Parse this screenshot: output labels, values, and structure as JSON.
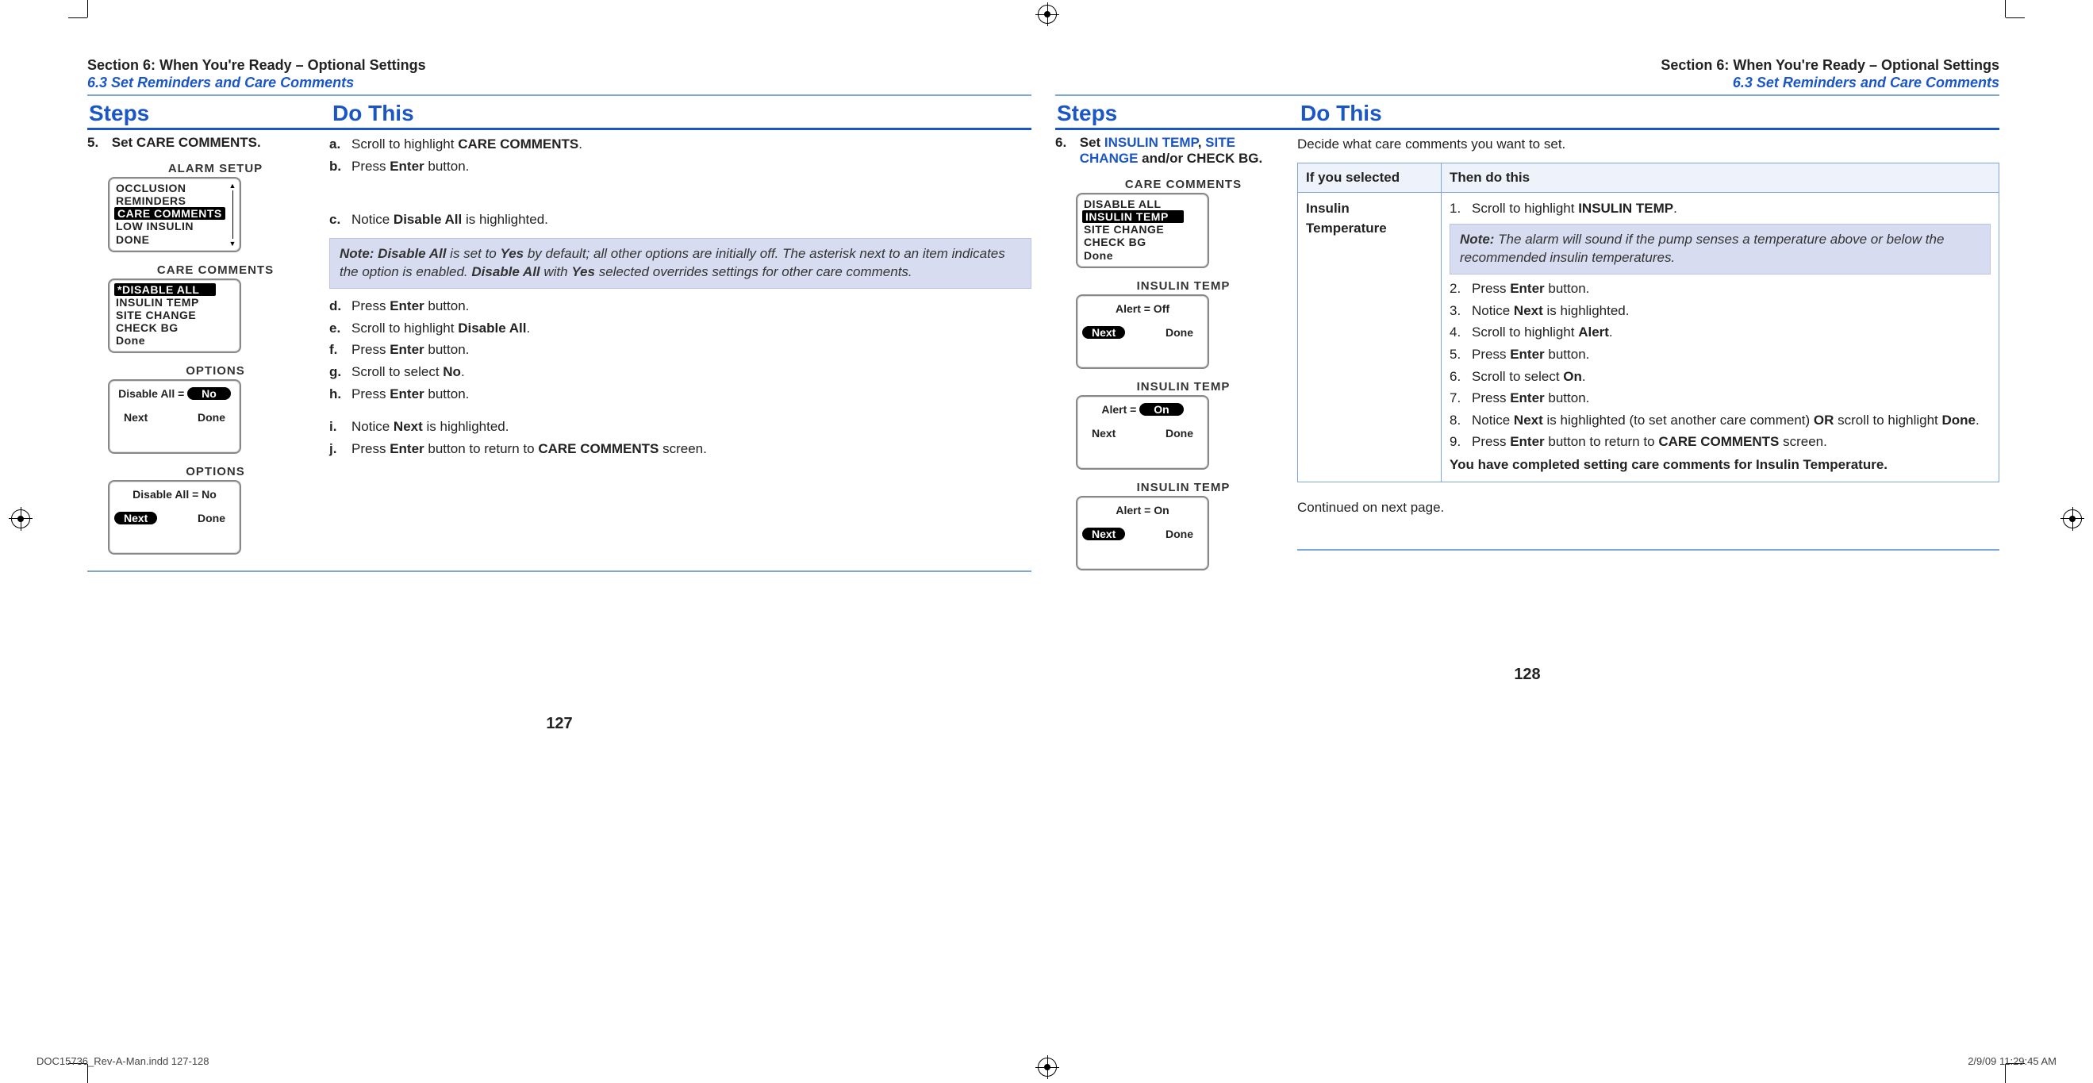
{
  "left": {
    "section_title": "Section 6: When You're Ready – Optional Settings",
    "section_sub": "6.3 Set Reminders and Care Comments",
    "col_steps": "Steps",
    "col_do": "Do This",
    "step_num": "5.",
    "step_text_pre": "Set ",
    "step_text_bold": "CARE COMMENTS.",
    "instr": {
      "a_pre": "Scroll to highlight ",
      "a_b": "CARE COMMENTS",
      "a_post": ".",
      "b_pre": "Press ",
      "b_b": "Enter",
      "b_post": " button.",
      "c_pre": "Notice ",
      "c_b": "Disable All",
      "c_post": " is highlighted.",
      "note_nb": "Note: Disable All",
      "note_mid1": " is set to ",
      "note_b1": "Yes",
      "note_mid2": " by default; all other options are initially off. The asterisk next to an item indicates the option is enabled. ",
      "note_b2": "Disable All",
      "note_mid3": " with ",
      "note_b3": "Yes",
      "note_mid4": " selected overrides settings for other care comments.",
      "d_pre": "Press ",
      "d_b": "Enter",
      "d_post": " button.",
      "e_pre": "Scroll to highlight ",
      "e_b": "Disable All",
      "e_post": ".",
      "f_pre": "Press ",
      "f_b": "Enter",
      "f_post": " button.",
      "g_pre": "Scroll to select ",
      "g_b": "No",
      "g_post": ".",
      "h_pre": "Press ",
      "h_b": "Enter",
      "h_post": " button.",
      "i_pre": "Notice ",
      "i_b": "Next",
      "i_post": " is highlighted.",
      "j_pre": "Press ",
      "j_b": "Enter",
      "j_mid": " button to return to ",
      "j_b2": "CARE COMMENTS",
      "j_post": " screen."
    },
    "dev1": {
      "title": "ALARM SETUP",
      "items": [
        "OCCLUSION",
        "REMINDERS",
        "CARE COMMENTS",
        "LOW INSULIN",
        "DONE"
      ],
      "sel": 2
    },
    "dev2": {
      "title": "CARE COMMENTS",
      "items": [
        "*DISABLE ALL",
        "INSULIN TEMP",
        "SITE CHANGE",
        "CHECK BG",
        "Done"
      ],
      "sel": 0
    },
    "dev3": {
      "title": "OPTIONS",
      "line_pre": "Disable All = ",
      "pill": "No",
      "btn_l": "Next",
      "btn_r": "Done"
    },
    "dev4": {
      "title": "OPTIONS",
      "line": "Disable All = No",
      "btn_l": "Next",
      "btn_r": "Done",
      "sel_l": true
    },
    "page_num": "127"
  },
  "right": {
    "section_title": "Section 6: When You're Ready – Optional Settings",
    "section_sub": "6.3 Set Reminders and Care Comments",
    "col_steps": "Steps",
    "col_do": "Do This",
    "step_num": "6.",
    "step_pre": "Set ",
    "step_blue1": "INSULIN TEMP",
    "step_sep1": ", ",
    "step_blue2": "SITE CHANGE",
    "step_post": " and/or CHECK BG.",
    "intro": "Decide what care comments you want to set.",
    "th1": "If you selected",
    "th2": "Then do this",
    "row1_label": "Insulin Temperature",
    "r": {
      "s1_pre": "Scroll to highlight ",
      "s1_b": "INSULIN TEMP",
      "s1_post": ".",
      "note_nb": "Note:",
      "note_body": " The alarm will sound if the pump senses a temperature above or below the recommended insulin temperatures.",
      "s2_pre": "Press ",
      "s2_b": "Enter",
      "s2_post": " button.",
      "s3_pre": "Notice ",
      "s3_b": "Next",
      "s3_post": " is highlighted.",
      "s4_pre": "Scroll to highlight ",
      "s4_b": "Alert",
      "s4_post": ".",
      "s5_pre": "Press ",
      "s5_b": "Enter",
      "s5_post": " button.",
      "s6_pre": "Scroll to select ",
      "s6_b": "On",
      "s6_post": ".",
      "s7_pre": "Press ",
      "s7_b": "Enter",
      "s7_post": " button.",
      "s8_pre": "Notice ",
      "s8_b": "Next",
      "s8_mid": " is highlighted (to set another care comment) ",
      "s8_b2": "OR",
      "s8_mid2": " scroll to highlight ",
      "s8_b3": "Done",
      "s8_post": ".",
      "s9_pre": "Press ",
      "s9_b": "Enter",
      "s9_mid": " button to return to ",
      "s9_b2": "CARE COMMENTS",
      "s9_post": " screen.",
      "done": "You have completed setting care comments for Insulin Temperature."
    },
    "dev1": {
      "title": "CARE COMMENTS",
      "items": [
        "DISABLE ALL",
        "INSULIN TEMP",
        "SITE CHANGE",
        "CHECK BG",
        "Done"
      ],
      "sel": 1
    },
    "dev2": {
      "title": "INSULIN TEMP",
      "line": "Alert = Off",
      "btn_l": "Next",
      "btn_r": "Done",
      "sel_l": true
    },
    "dev3": {
      "title": "INSULIN TEMP",
      "line_pre": "Alert = ",
      "pill": "On",
      "btn_l": "Next",
      "btn_r": "Done"
    },
    "dev4": {
      "title": "INSULIN TEMP",
      "line": "Alert = On",
      "btn_l": "Next",
      "btn_r": "Done",
      "sel_l": true
    },
    "continued": "Continued on next page.",
    "page_num": "128"
  },
  "footer": {
    "left": "DOC15736_Rev-A-Man.indd   127-128",
    "right": "2/9/09   11:29:45 AM"
  }
}
